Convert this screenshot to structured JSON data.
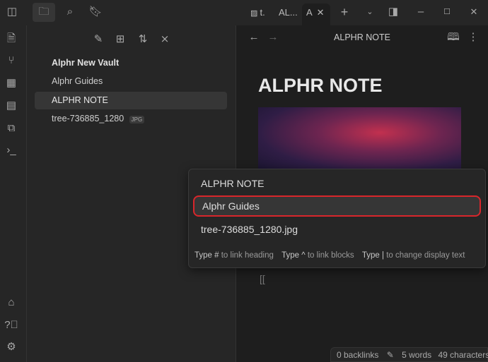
{
  "tabs": [
    {
      "label": "t."
    },
    {
      "label": "AL..."
    },
    {
      "label": "A"
    }
  ],
  "editor": {
    "header_title": "ALPHR NOTE",
    "heading": "ALPHR NOTE",
    "cursor_text": "[["
  },
  "sidebar": {
    "items": [
      {
        "label": "Alphr New Vault"
      },
      {
        "label": "Alphr Guides"
      },
      {
        "label": "ALPHR NOTE"
      },
      {
        "label": "tree-736885_1280",
        "badge": "JPG"
      }
    ]
  },
  "popup": {
    "suggestions": [
      {
        "label": "ALPHR NOTE"
      },
      {
        "label": "Alphr Guides"
      },
      {
        "label": "tree-736885_1280.jpg"
      }
    ],
    "hints": [
      {
        "key": "Type #",
        "text": " to link heading"
      },
      {
        "key": "Type ^",
        "text": " to link blocks"
      },
      {
        "key": "Type |",
        "text": " to change display text"
      }
    ],
    "highlight_color": "#d9262b"
  },
  "status": {
    "backlinks": "0 backlinks",
    "words": "5 words",
    "characters": "49 characters"
  }
}
